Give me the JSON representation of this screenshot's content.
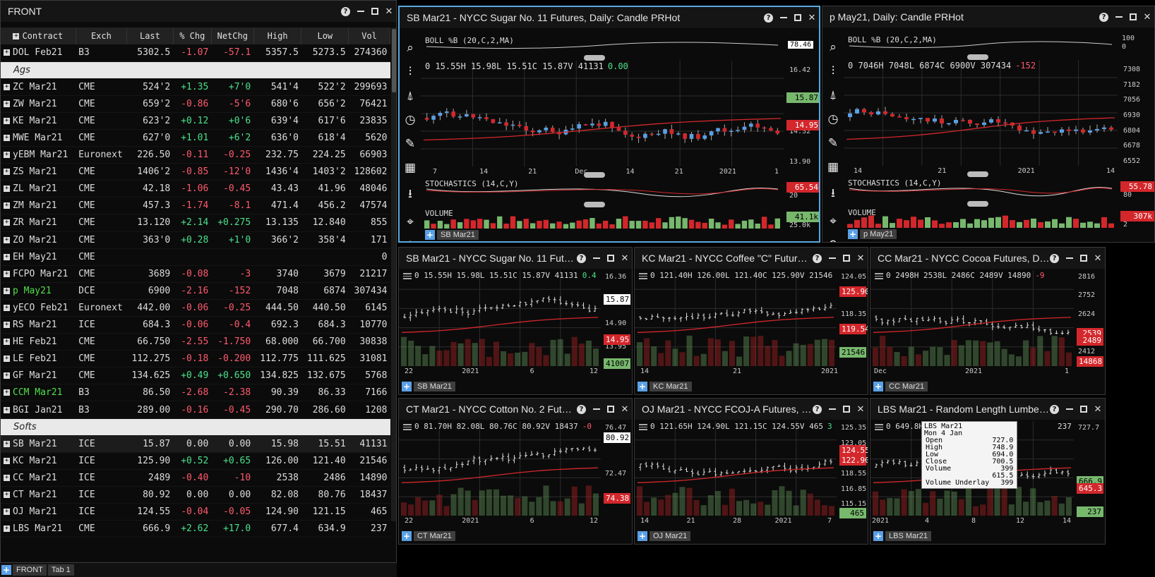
{
  "quotes": {
    "title": "FRONT",
    "columns": [
      "Contract",
      "Exch",
      "Last",
      "% Chg",
      "NetChg",
      "High",
      "Low",
      "Vol"
    ],
    "rows": [
      {
        "type": "row",
        "c": [
          "DOL Feb21",
          "B3",
          "5302.5",
          "-1.07",
          "-57.1",
          "5357.5",
          "5273.5",
          "274360"
        ],
        "dir": "neg"
      },
      {
        "type": "group",
        "label": "Ags"
      },
      {
        "type": "row",
        "c": [
          "ZC Mar21",
          "CME",
          "524'2",
          "+1.35",
          "+7'0",
          "541'4",
          "522'2",
          "299693"
        ],
        "dir": "pos"
      },
      {
        "type": "row",
        "c": [
          "ZW Mar21",
          "CME",
          "659'2",
          "-0.86",
          "-5'6",
          "680'6",
          "656'2",
          "76421"
        ],
        "dir": "neg"
      },
      {
        "type": "row",
        "c": [
          "KE Mar21",
          "CME",
          "623'2",
          "+0.12",
          "+0'6",
          "639'4",
          "617'6",
          "23835"
        ],
        "dir": "pos"
      },
      {
        "type": "row",
        "c": [
          "MWE Mar21",
          "CME",
          "627'0",
          "+1.01",
          "+6'2",
          "636'0",
          "618'4",
          "5620"
        ],
        "dir": "pos"
      },
      {
        "type": "row",
        "c": [
          "yEBM Mar21",
          "Euronext",
          "226.50",
          "-0.11",
          "-0.25",
          "232.75",
          "224.25",
          "66903"
        ],
        "dir": "neg"
      },
      {
        "type": "row",
        "c": [
          "ZS Mar21",
          "CME",
          "1406'2",
          "-0.85",
          "-12'0",
          "1436'4",
          "1403'2",
          "128602"
        ],
        "dir": "neg"
      },
      {
        "type": "row",
        "c": [
          "ZL Mar21",
          "CME",
          "42.18",
          "-1.06",
          "-0.45",
          "43.43",
          "41.96",
          "48046"
        ],
        "dir": "neg"
      },
      {
        "type": "row",
        "c": [
          "ZM Mar21",
          "CME",
          "457.3",
          "-1.74",
          "-8.1",
          "471.4",
          "456.2",
          "47574"
        ],
        "dir": "neg"
      },
      {
        "type": "row",
        "c": [
          "ZR Mar21",
          "CME",
          "13.120",
          "+2.14",
          "+0.275",
          "13.135",
          "12.840",
          "855"
        ],
        "dir": "pos"
      },
      {
        "type": "row",
        "c": [
          "ZO Mar21",
          "CME",
          "363'0",
          "+0.28",
          "+1'0",
          "366'2",
          "358'4",
          "171"
        ],
        "dir": "pos"
      },
      {
        "type": "row",
        "c": [
          "EH May21",
          "CME",
          "",
          "",
          "",
          "",
          "",
          "0"
        ],
        "dir": ""
      },
      {
        "type": "row",
        "c": [
          "FCPO Mar21",
          "CME",
          "3689",
          "-0.08",
          "-3",
          "3740",
          "3679",
          "21217"
        ],
        "dir": "neg"
      },
      {
        "type": "row",
        "c": [
          "p May21",
          "DCE",
          "6900",
          "-2.16",
          "-152",
          "7048",
          "6874",
          "307434"
        ],
        "dir": "neg",
        "hl": true
      },
      {
        "type": "row",
        "c": [
          "yECO Feb21",
          "Euronext",
          "442.00",
          "-0.06",
          "-0.25",
          "444.50",
          "440.50",
          "6145"
        ],
        "dir": "neg"
      },
      {
        "type": "row",
        "c": [
          "RS Mar21",
          "ICE",
          "684.3",
          "-0.06",
          "-0.4",
          "692.3",
          "684.3",
          "10770"
        ],
        "dir": "neg"
      },
      {
        "type": "row",
        "c": [
          "HE Feb21",
          "CME",
          "66.750",
          "-2.55",
          "-1.750",
          "68.000",
          "66.700",
          "30838"
        ],
        "dir": "neg"
      },
      {
        "type": "row",
        "c": [
          "LE Feb21",
          "CME",
          "112.275",
          "-0.18",
          "-0.200",
          "112.775",
          "111.625",
          "31081"
        ],
        "dir": "neg"
      },
      {
        "type": "row",
        "c": [
          "GF Mar21",
          "CME",
          "134.625",
          "+0.49",
          "+0.650",
          "134.825",
          "132.675",
          "5768"
        ],
        "dir": "pos"
      },
      {
        "type": "row",
        "c": [
          "CCM Mar21",
          "B3",
          "86.50",
          "-2.68",
          "-2.38",
          "90.39",
          "86.33",
          "7166"
        ],
        "dir": "neg",
        "hl": true
      },
      {
        "type": "row",
        "c": [
          "BGI Jan21",
          "B3",
          "289.00",
          "-0.16",
          "-0.45",
          "290.70",
          "286.60",
          "1208"
        ],
        "dir": "neg"
      },
      {
        "type": "group",
        "label": "Softs"
      },
      {
        "type": "row",
        "c": [
          "SB Mar21",
          "ICE",
          "15.87",
          "0.00",
          "0.00",
          "15.98",
          "15.51",
          "41131"
        ],
        "dir": "",
        "sel": true
      },
      {
        "type": "row",
        "c": [
          "KC Mar21",
          "ICE",
          "125.90",
          "+0.52",
          "+0.65",
          "126.00",
          "121.40",
          "21546"
        ],
        "dir": "pos"
      },
      {
        "type": "row",
        "c": [
          "CC Mar21",
          "ICE",
          "2489",
          "-0.40",
          "-10",
          "2538",
          "2486",
          "14890"
        ],
        "dir": "neg"
      },
      {
        "type": "row",
        "c": [
          "CT Mar21",
          "ICE",
          "80.92",
          "0.00",
          "0.00",
          "82.08",
          "80.76",
          "18437"
        ],
        "dir": ""
      },
      {
        "type": "row",
        "c": [
          "OJ Mar21",
          "ICE",
          "124.55",
          "-0.04",
          "-0.05",
          "124.90",
          "121.15",
          "465"
        ],
        "dir": "neg"
      },
      {
        "type": "row",
        "c": [
          "LBS Mar21",
          "CME",
          "666.9",
          "+2.62",
          "+17.0",
          "677.4",
          "634.9",
          "237"
        ],
        "dir": "pos"
      }
    ]
  },
  "tabs": [
    "FRONT",
    "Tab 1"
  ],
  "panes": [
    {
      "id": "p1",
      "title": "SB Mar21 - NYCC Sugar No. 11 Futures, Daily: Candle PRHot",
      "symbol": "SB Mar21",
      "active": true,
      "boll": "BOLL %B (20,C,2,MA)",
      "boll_axis": [
        "78.46"
      ],
      "ohlc": "0  15.55H  15.98L  15.51C  15.87V  41131",
      "ohlc_chg": "0.00",
      "ohlc_dir": "pos",
      "axis": [
        "16.42",
        "15.58",
        "14.32",
        "13.90"
      ],
      "tags": [
        {
          "t": "15.87",
          "c": "green",
          "y": 0.3
        },
        {
          "t": "14.95",
          "c": "red",
          "y": 0.56
        }
      ],
      "x_labels": [
        "7",
        "14",
        "21",
        "Dec",
        "14",
        "21",
        "2021",
        "1"
      ],
      "stoch": "STOCHASTICS (14,C,Y)",
      "stoch_tag": "65.54",
      "stoch_axis": "20",
      "volume": "VOLUME",
      "vol_tag": "41.1k",
      "vol_axis": "25.0k"
    },
    {
      "id": "p2",
      "title": "p May21, Daily: Candle PRHot",
      "symbol": "p May21",
      "boll": "BOLL %B (20,C,2,MA)",
      "boll_axis": [
        "100",
        "0"
      ],
      "ohlc": "0  7046H  7048L  6874C  6900V  307434",
      "ohlc_chg": "-152",
      "ohlc_dir": "neg",
      "axis": [
        "7308",
        "7182",
        "7056",
        "6930",
        "6804",
        "6678",
        "6552"
      ],
      "tags": [],
      "x_labels": [
        "14",
        "21",
        "2021",
        "14"
      ],
      "stoch": "STOCHASTICS (14,C,Y)",
      "stoch_tag": "55.78",
      "stoch_axis": "80",
      "volume": "VOLUME",
      "vol_tag": "307k",
      "vol_axis": "2"
    },
    {
      "id": "p3",
      "title": "SB Mar21 - NYCC Sugar No. 11 Futures, Daily: Candle PRHot",
      "symbol": "SB Mar21",
      "ohlc": "0  15.55H  15.98L  15.51C  15.87V  41131",
      "ohlc_chg": "0.4",
      "ohlc_dir": "pos",
      "axis": [
        "16.36",
        "15.40",
        "14.90",
        "13.95"
      ],
      "tags": [
        {
          "t": "15.87",
          "c": "white",
          "y": 0.25
        },
        {
          "t": "14.95",
          "c": "red",
          "y": 0.67
        },
        {
          "t": "41007",
          "c": "green",
          "y": 0.92
        }
      ],
      "x_labels": [
        "22",
        "2021",
        "6",
        "12"
      ]
    },
    {
      "id": "p4",
      "title": "KC Mar21 - NYCC Coffee \"C\" Futures, Daily: Candle PRHot",
      "symbol": "KC Mar21",
      "ohlc": "0  121.40H  126.00L  121.40C  125.90V  21546",
      "ohlc_chg": "",
      "ohlc_dir": "pos",
      "axis": [
        "124.05",
        "121.40",
        "118.35",
        "113.35",
        "110.80"
      ],
      "tags": [
        {
          "t": "125.90",
          "c": "red",
          "y": 0.17
        },
        {
          "t": "119.54",
          "c": "red",
          "y": 0.56
        },
        {
          "t": "21546",
          "c": "green",
          "y": 0.8
        }
      ],
      "x_labels": [
        "14",
        "21",
        "2021"
      ]
    },
    {
      "id": "p5",
      "title": "CC Mar21 - NYCC Cocoa Futures, Daily: Candle PRHot",
      "symbol": "CC Mar21",
      "ohlc": "0  2498H  2538L  2486C  2489V  14890",
      "ohlc_chg": "-9",
      "ohlc_dir": "neg",
      "axis": [
        "2816",
        "2752",
        "2624",
        "2497",
        "2412"
      ],
      "tags": [
        {
          "t": "2539",
          "c": "red",
          "y": 0.6
        },
        {
          "t": "2489",
          "c": "red",
          "y": 0.68
        },
        {
          "t": "14868",
          "c": "red",
          "y": 0.9
        }
      ],
      "x_labels": [
        "Dec",
        "2021",
        "1"
      ]
    },
    {
      "id": "p6",
      "title": "CT Mar21 - NYCC Cotton No. 2 Futures, Daily: Candle PRHot",
      "symbol": "CT Mar21",
      "ohlc": "0  81.70H  82.08L  80.76C  80.92V  18437",
      "ohlc_chg": "-0",
      "ohlc_dir": "neg",
      "axis": [
        "76.47",
        "72.47"
      ],
      "tags": [
        {
          "t": "80.92",
          "c": "white",
          "y": 0.12
        },
        {
          "t": "74.38",
          "c": "red",
          "y": 0.76
        }
      ],
      "x_labels": [
        "22",
        "2021",
        "6",
        "12"
      ]
    },
    {
      "id": "p7",
      "title": "OJ Mar21 - NYCC FCOJ-A Futures, Daily: Candle PRHot",
      "symbol": "OJ Mar21",
      "ohlc": "0  121.65H  124.90L  121.15C  124.55V  465",
      "ohlc_chg": "3",
      "ohlc_dir": "pos",
      "axis": [
        "125.35",
        "123.05",
        "120.25",
        "118.55",
        "116.85",
        "115.15"
      ],
      "tags": [
        {
          "t": "124.55",
          "c": "red",
          "y": 0.25
        },
        {
          "t": "122.90",
          "c": "red",
          "y": 0.36
        },
        {
          "t": "465",
          "c": "green",
          "y": 0.92
        }
      ],
      "x_labels": [
        "14",
        "21",
        "28",
        "2021",
        "7"
      ]
    },
    {
      "id": "p8",
      "title": "LBS Mar21 - Random Length Lumber Futures, Daily: Candle PRHot",
      "symbol": "LBS Mar21",
      "ohlc": "0  649.8H",
      "ohlc_tail": "237",
      "ohlc_chg": "17.0",
      "ohlc_dir": "pos",
      "axis": [
        "727.7"
      ],
      "tags": [
        {
          "t": "666.9",
          "c": "green",
          "y": 0.58
        },
        {
          "t": "645.3",
          "c": "red",
          "y": 0.66
        },
        {
          "t": "237",
          "c": "green",
          "y": 0.9
        }
      ],
      "x_labels": [
        "2021",
        "4",
        "8",
        "12",
        "14"
      ],
      "tooltip": {
        "head": "LBS Mar21",
        "date": "Mon 4 Jan",
        "rows": [
          [
            "Open",
            "727.0"
          ],
          [
            "High",
            "748.9"
          ],
          [
            "Low",
            "694.0"
          ],
          [
            "Close",
            "700.5"
          ],
          [
            "Volume",
            "399"
          ],
          [
            "",
            "615.5"
          ],
          [
            "Volume Underlay",
            "399"
          ]
        ]
      }
    }
  ],
  "colors": {
    "up": "#77b86d",
    "down": "#d3272b",
    "ma": "#d3272b",
    "accent": "#58a9e0"
  }
}
